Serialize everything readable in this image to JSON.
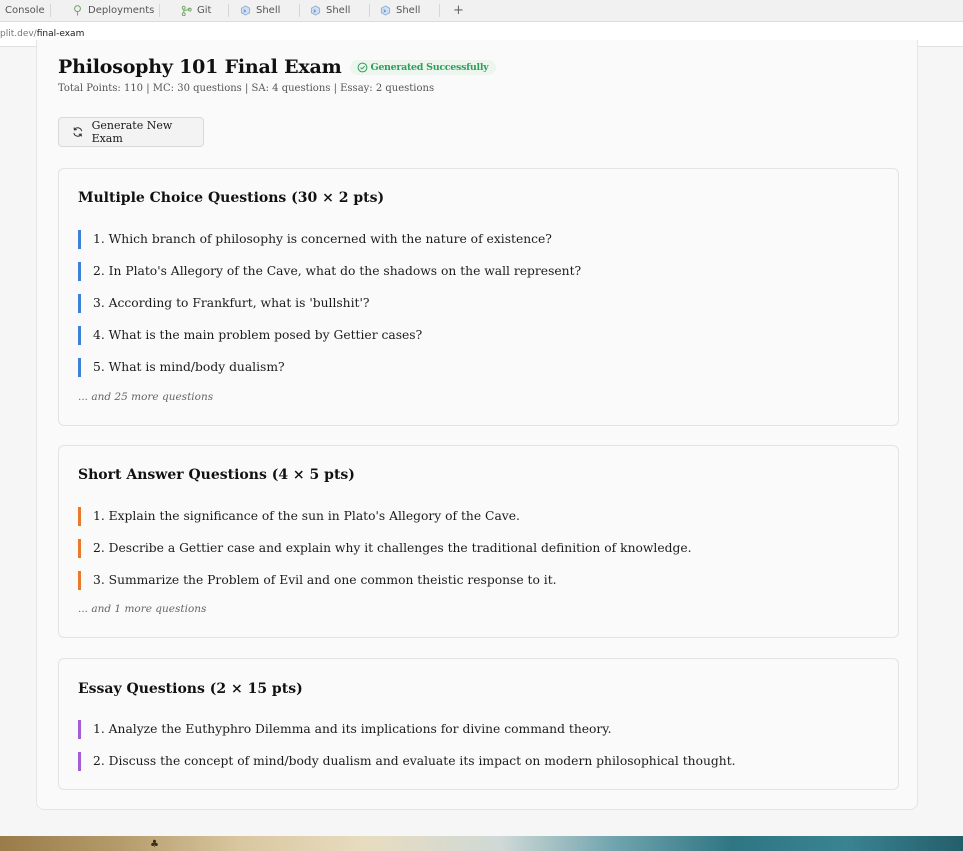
{
  "tabs": [
    {
      "label": "Console",
      "icon": "none"
    },
    {
      "label": "Deployments",
      "icon": "deployments-icon"
    },
    {
      "label": "Git",
      "icon": "git-icon"
    },
    {
      "label": "Shell",
      "icon": "shell-icon"
    },
    {
      "label": "Shell",
      "icon": "shell-icon"
    },
    {
      "label": "Shell",
      "icon": "shell-icon"
    }
  ],
  "new_tab_label": "+",
  "url": {
    "host": "plit.dev/",
    "path": "final-exam"
  },
  "exam": {
    "title": "Philosophy 101 Final Exam",
    "status_badge": "Generated Successfully",
    "meta": "Total Points: 110 | MC: 30 questions | SA: 4 questions | Essay: 2 questions",
    "generate_button": "Generate New Exam"
  },
  "sections": {
    "multiple_choice": {
      "title": "Multiple Choice Questions (30 × 2 pts)",
      "questions": [
        "1. Which branch of philosophy is concerned with the nature of existence?",
        "2. In Plato's Allegory of the Cave, what do the shadows on the wall represent?",
        "3. According to Frankfurt, what is 'bullshit'?",
        "4. What is the main problem posed by Gettier cases?",
        "5. What is mind/body dualism?"
      ],
      "more": "... and 25 more questions"
    },
    "short_answer": {
      "title": "Short Answer Questions (4 × 5 pts)",
      "questions": [
        "1. Explain the significance of the sun in Plato's Allegory of the Cave.",
        "2. Describe a Gettier case and explain why it challenges the traditional definition of knowledge.",
        "3. Summarize the Problem of Evil and one common theistic response to it."
      ],
      "more": "... and 1 more questions"
    },
    "essay": {
      "title": "Essay Questions (2 × 15 pts)",
      "questions": [
        "1. Analyze the Euthyphro Dilemma and its implications for divine command theory.",
        "2. Discuss the concept of mind/body dualism and evaluate its impact on modern philosophical thought."
      ]
    }
  },
  "colors": {
    "mc_accent": "#3c82d6",
    "sa_accent": "#ea7a28",
    "essay_accent": "#a45cd9",
    "success": "#2f9e58"
  }
}
